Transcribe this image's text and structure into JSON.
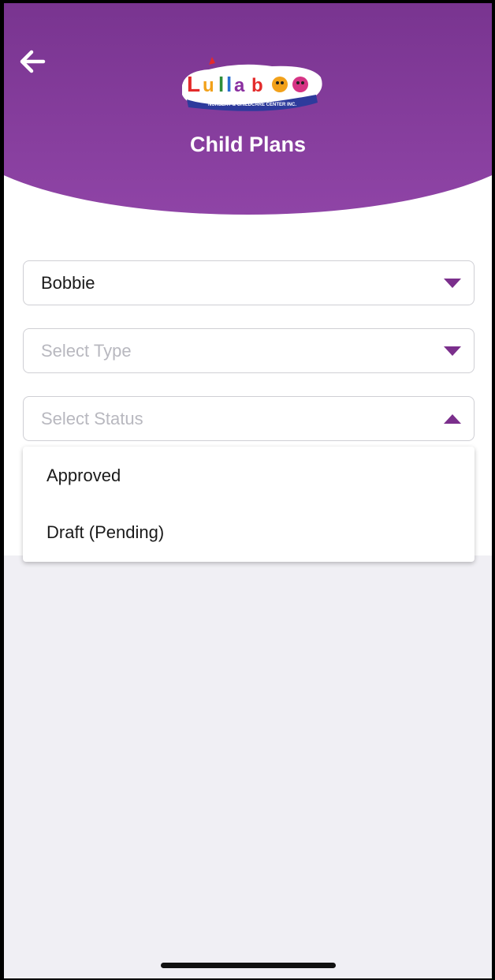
{
  "header": {
    "title": "Child Plans",
    "back_icon": "arrow-left-icon",
    "logo_text": "Lullaboo",
    "logo_subtext": "NURSERY & CHILDCARE CENTER INC."
  },
  "filters": {
    "child": {
      "value": "Bobbie",
      "icon": "caret-down-icon"
    },
    "type": {
      "placeholder": "Select Type",
      "icon": "caret-down-icon"
    },
    "status": {
      "placeholder": "Select Status",
      "icon": "caret-up-icon",
      "expanded": true
    }
  },
  "status_options": [
    "Approved",
    "Draft (Pending)"
  ],
  "colors": {
    "header_purple": "#7a3591",
    "accent": "#7b2f8c",
    "background": "#f0eff4"
  }
}
